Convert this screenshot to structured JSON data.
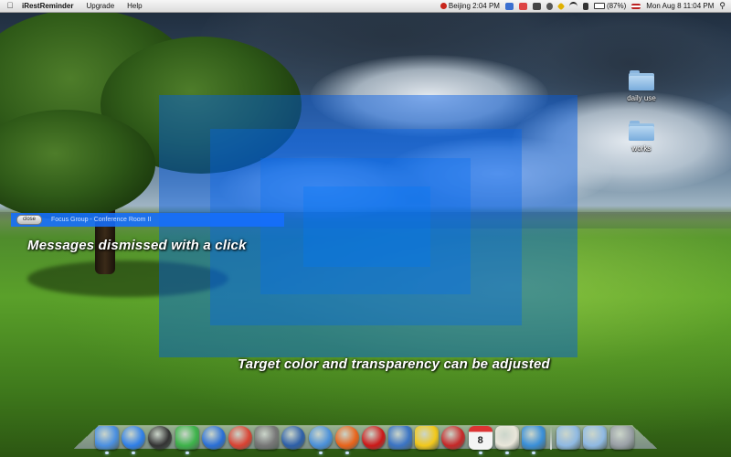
{
  "menubar": {
    "app_name": "iRestReminder",
    "menus": [
      "Upgrade",
      "Help"
    ],
    "clock_city": "Beijing 2:04 PM",
    "battery": "(87%)",
    "datetime": "Mon Aug 8  11:04 PM"
  },
  "desktop": {
    "folders": [
      {
        "label": "daily use"
      },
      {
        "label": "works"
      }
    ]
  },
  "reminder": {
    "close_label": "close",
    "message": "Focus Group - Conference Room II"
  },
  "captions": {
    "dismiss": "Messages dismissed with a click",
    "target": "Target color and transparency can be adjusted"
  },
  "overlay": {
    "color": "#0a5fe8"
  },
  "dock": {
    "apps": [
      {
        "icon": "finder-icon",
        "color": "#4a8fe0"
      },
      {
        "icon": "app-store-icon",
        "color": "#2f7fe8"
      },
      {
        "icon": "dashboard-icon",
        "color": "#333333"
      },
      {
        "icon": "messenger-icon",
        "color": "#3db34a"
      },
      {
        "icon": "itunes-icon",
        "color": "#2a6fd6"
      },
      {
        "icon": "chrome-icon",
        "color": "#d94232"
      },
      {
        "icon": "photo-frame-icon",
        "color": "#777777"
      },
      {
        "icon": "google-earth-icon",
        "color": "#2d5fa8"
      },
      {
        "icon": "safari-icon",
        "color": "#4a90d9"
      },
      {
        "icon": "firefox-icon",
        "color": "#e8631a"
      },
      {
        "icon": "opera-icon",
        "color": "#cc1818"
      },
      {
        "icon": "xcode-icon",
        "color": "#3b74c4"
      },
      {
        "icon": "txt-sign-icon",
        "color": "#f2c81a"
      },
      {
        "icon": "zotero-icon",
        "color": "#c62828"
      },
      {
        "icon": "calendar-icon",
        "color": "#eeeeee",
        "text": "8"
      },
      {
        "icon": "textedit-icon",
        "color": "#e9e6da"
      },
      {
        "icon": "preview-eye-icon",
        "color": "#3a8fd8"
      }
    ],
    "stacks": [
      {
        "icon": "applications-folder-icon",
        "color": "#8fb9e2"
      },
      {
        "icon": "documents-folder-icon",
        "color": "#8fb9e2"
      },
      {
        "icon": "trash-icon",
        "color": "#9aa0a6"
      }
    ]
  }
}
